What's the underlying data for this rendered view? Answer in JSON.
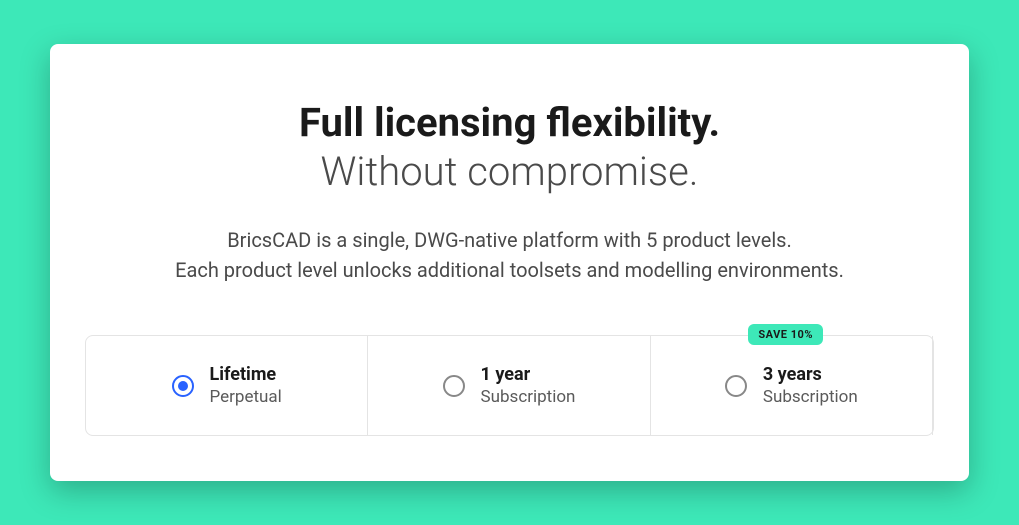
{
  "heading": {
    "bold": "Full licensing flexibility.",
    "light": "Without compromise."
  },
  "description": {
    "line1": "BricsCAD is a single, DWG-native platform with 5 product levels.",
    "line2": "Each product level unlocks additional toolsets and modelling environments."
  },
  "options": [
    {
      "title": "Lifetime",
      "subtitle": "Perpetual",
      "selected": true
    },
    {
      "title": "1 year",
      "subtitle": "Subscription",
      "selected": false
    },
    {
      "title": "3 years",
      "subtitle": "Subscription",
      "selected": false,
      "badge": "SAVE 10%"
    }
  ]
}
